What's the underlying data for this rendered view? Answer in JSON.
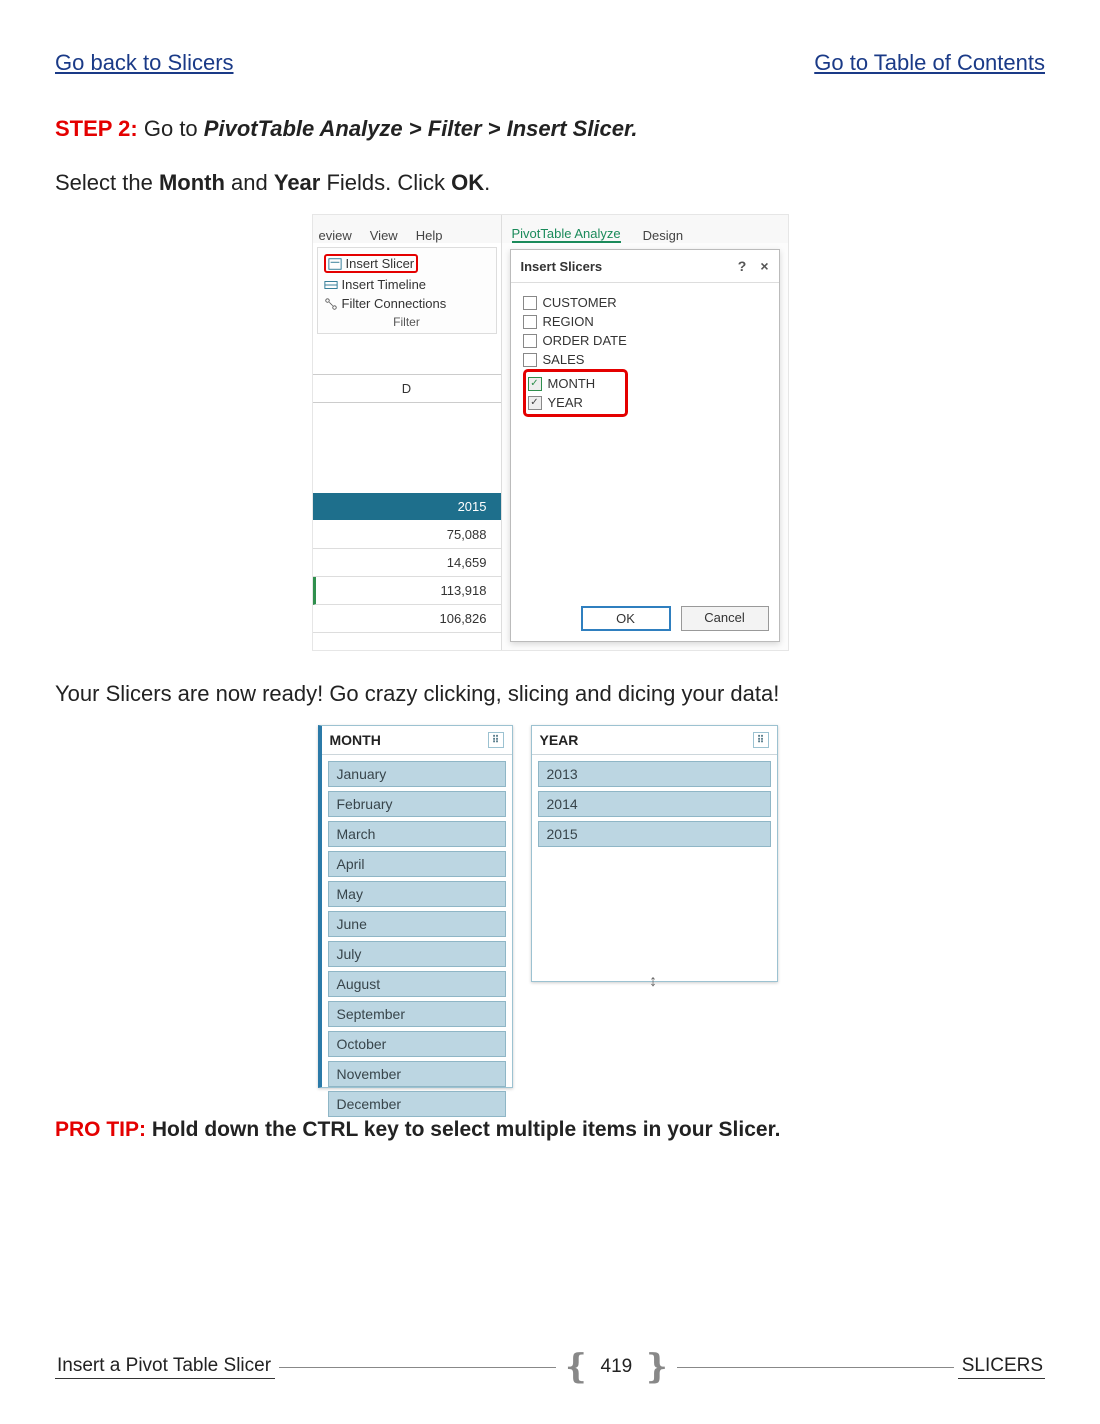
{
  "nav": {
    "back": "Go back to Slicers",
    "toc": "Go to Table of Contents"
  },
  "step": {
    "label": "STEP 2:",
    "pre": " Go to ",
    "path1": "PivotTable Analyze",
    "sep": " > ",
    "path2": "Filter",
    "path3": "Insert Slicer."
  },
  "body": {
    "l1a": "Select the ",
    "l1b": "Month",
    "l1c": "  and ",
    "l1d": "Year",
    "l1e": " Fields. Click ",
    "l1f": "OK",
    "l1g": ".",
    "ready": "Your Slicers are now ready!  Go crazy clicking, slicing and dicing your data!"
  },
  "ss1": {
    "tabs_left": [
      "eview",
      "View",
      "Help"
    ],
    "tabs_right": [
      "PivotTable Analyze",
      "Design"
    ],
    "filter": {
      "insert_slicer": "Insert Slicer",
      "insert_timeline": "Insert Timeline",
      "filter_conn": "Filter Connections",
      "group": "Filter"
    },
    "col": "D",
    "year_cell": "2015",
    "values": [
      "75,088",
      "14,659",
      "113,918",
      "106,826"
    ],
    "dialog": {
      "title": "Insert Slicers",
      "help": "?",
      "close": "×",
      "items": [
        {
          "label": "CUSTOMER",
          "checked": false
        },
        {
          "label": "REGION",
          "checked": false
        },
        {
          "label": "ORDER DATE",
          "checked": false
        },
        {
          "label": "SALES",
          "checked": false
        },
        {
          "label": "MONTH",
          "checked": true
        },
        {
          "label": "YEAR",
          "checked": true
        }
      ],
      "ok": "OK",
      "cancel": "Cancel"
    }
  },
  "ss2": {
    "month": {
      "title": "MONTH",
      "items": [
        "January",
        "February",
        "March",
        "April",
        "May",
        "June",
        "July",
        "August",
        "September",
        "October",
        "November",
        "December"
      ]
    },
    "year": {
      "title": "YEAR",
      "items": [
        "2013",
        "2014",
        "2015"
      ]
    }
  },
  "protip": {
    "label": "PRO TIP:",
    "text": " Hold down the CTRL key to select multiple items in your Slicer."
  },
  "footer": {
    "title": "Insert a Pivot Table Slicer",
    "page": "419",
    "section": "SLICERS"
  }
}
